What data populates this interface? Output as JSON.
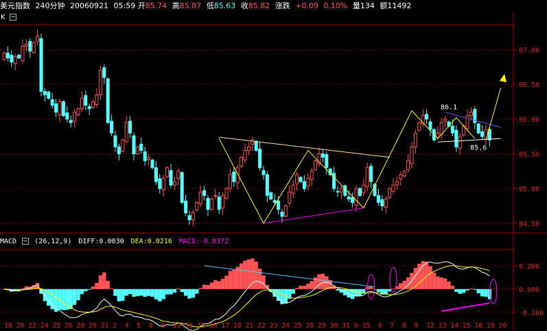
{
  "header": {
    "symbol": "美元指数",
    "period": "240分钟",
    "date": "20060921",
    "time": "05:59",
    "open_label": "开",
    "open": "85.74",
    "high_label": "高",
    "high": "85.87",
    "low_label": "低",
    "low": "85.63",
    "close_label": "收",
    "close": "85.82",
    "change_label": "涨跌",
    "change": "+0.09",
    "change_pct": "0.10%",
    "volume_label": "量",
    "volume": "134",
    "amount_label": "额",
    "amount": "11492"
  },
  "main_panel_tag": "K",
  "indicator": {
    "name": "MACD",
    "params": "(26,12,9)",
    "diff_label": "DIFF:",
    "diff": "0.0030",
    "dea_label": "DEA:",
    "dea": "0.0216",
    "macd_label": "MACD:",
    "macd": "-0.0372"
  },
  "colors": {
    "up": "#ff5454",
    "down": "#54ffff",
    "axis": "#aa0000",
    "grid": "#7a0000",
    "label": "#e02020",
    "diff": "#ffffff",
    "dea": "#ffff00",
    "macd": "#ff00ff"
  },
  "chart_data": [
    {
      "type": "candlestick",
      "ylim": [
        84.36,
        87.36
      ],
      "y_ticks": [
        "87.00",
        "86.50",
        "86.00",
        "85.50",
        "85.00",
        "84.50"
      ],
      "close_series": [
        86.95,
        86.88,
        86.82,
        86.9,
        86.88,
        87.05,
        87.08,
        86.98,
        87.1,
        87.2,
        86.4,
        86.35,
        86.3,
        86.2,
        86.1,
        86.25,
        86.05,
        86.0,
        85.95,
        86.1,
        86.15,
        86.3,
        86.2,
        86.15,
        86.25,
        86.35,
        86.7,
        86.6,
        85.95,
        85.8,
        85.6,
        85.5,
        85.7,
        85.95,
        85.8,
        85.5,
        85.6,
        85.55,
        85.4,
        85.45,
        85.3,
        85.1,
        85.0,
        85.15,
        85.3,
        85.05,
        85.1,
        85.25,
        84.8,
        84.65,
        84.55,
        84.65,
        84.8,
        84.95,
        84.9,
        84.7,
        84.85,
        84.9,
        84.7,
        84.9,
        85.0,
        85.2,
        85.1,
        85.3,
        85.45,
        85.55,
        85.6,
        85.7,
        85.55,
        85.3,
        85.2,
        84.9,
        84.85,
        84.8,
        84.7,
        84.6,
        84.75,
        84.95,
        85.05,
        85.2,
        85.1,
        85.0,
        85.15,
        85.25,
        85.4,
        85.5,
        85.45,
        85.3,
        85.2,
        85.0,
        84.95,
        85.0,
        84.9,
        84.85,
        84.8,
        85.0,
        84.9,
        85.05,
        85.3,
        85.1,
        84.9,
        84.8,
        84.75,
        84.85,
        85.0,
        85.05,
        85.1,
        85.2,
        85.25,
        85.4,
        85.6,
        85.8,
        85.95,
        86.05,
        86.0,
        85.85,
        85.7,
        85.8,
        85.95,
        86.0,
        85.9,
        85.8,
        85.6,
        85.75,
        85.9,
        86.05,
        86.1,
        85.95,
        85.8,
        85.75,
        85.85,
        85.7
      ],
      "annotations": [
        {
          "text": "86.1",
          "value": 86.1
        },
        {
          "text": "85.6",
          "value": 85.6
        }
      ]
    },
    {
      "type": "bar",
      "name": "MACD",
      "ylim": [
        -0.26,
        0.34
      ],
      "y_ticks": [
        "0.200",
        "0.000",
        "-0.200"
      ],
      "x_tick_labels": [
        "18",
        "20",
        "22",
        "24",
        "25",
        "26",
        "28",
        "29",
        "31",
        "2",
        "4",
        "5",
        "8",
        "9",
        "10",
        "11",
        "15",
        "16",
        "17",
        "18",
        "21",
        "22",
        "23",
        "24",
        "25",
        "28",
        "29",
        "30",
        "31",
        "9-1",
        "5",
        "6",
        "7",
        "8",
        "9",
        "12",
        "13",
        "14",
        "15",
        "18",
        "19",
        "20"
      ]
    }
  ]
}
